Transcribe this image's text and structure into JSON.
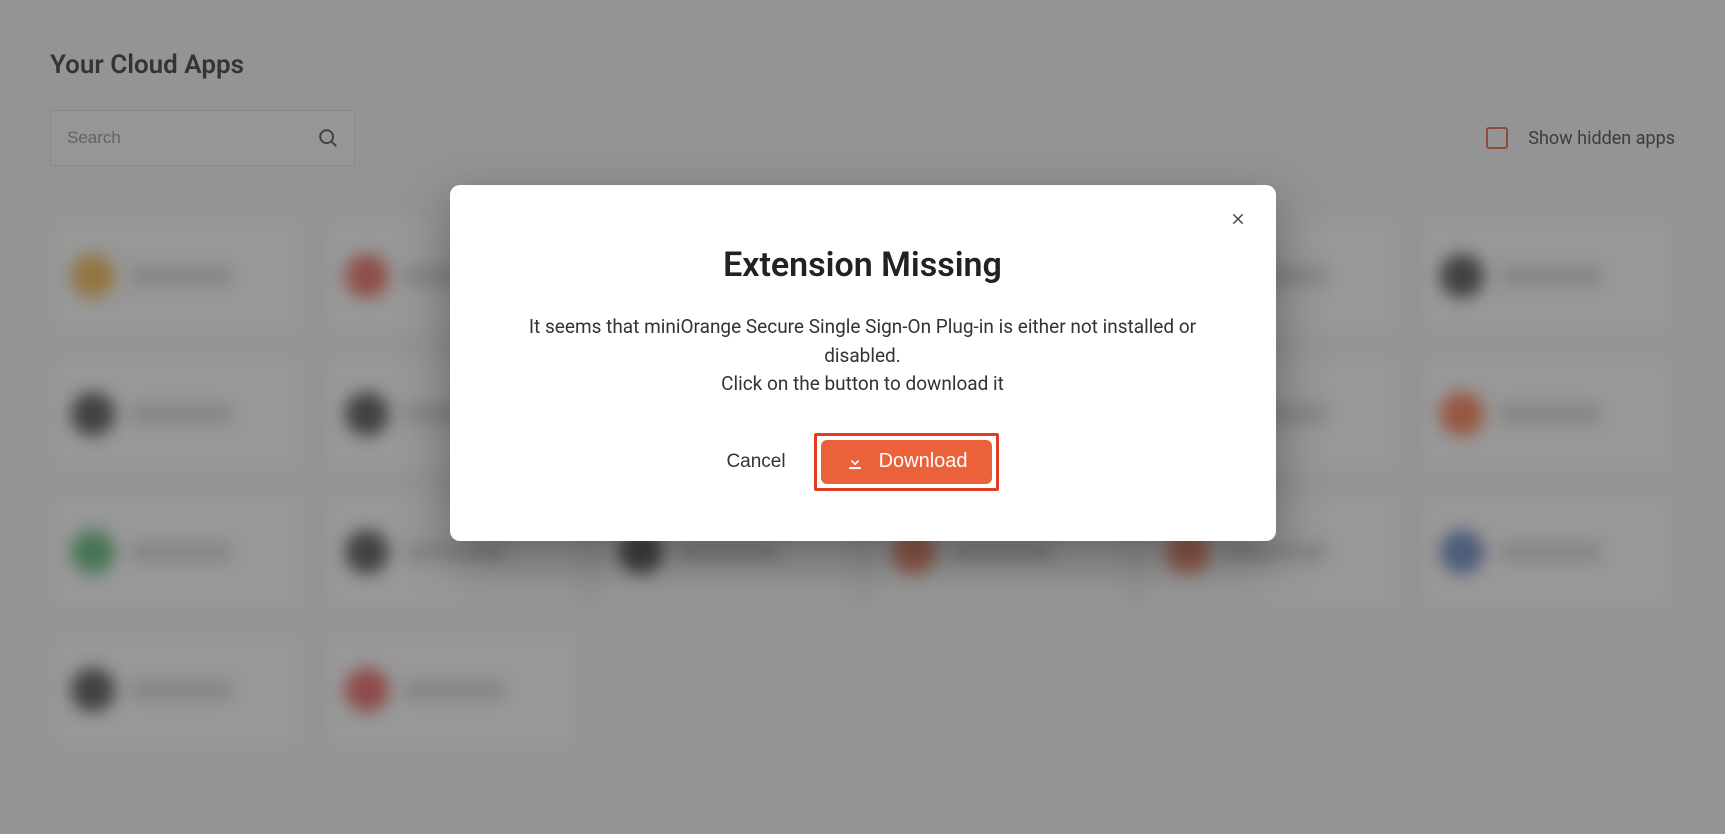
{
  "header": {
    "title": "Your Cloud Apps"
  },
  "search": {
    "placeholder": "Search"
  },
  "hidden_apps": {
    "label": "Show hidden apps"
  },
  "app_icon_colors": [
    "#f5a623",
    "#ea4335",
    "#6b6b6b",
    "#007aff",
    "#333333",
    "#222222",
    "#222222",
    "#222222",
    "#aaaaaa",
    "#eb6139",
    "#d4d4d4",
    "#ff5722",
    "#34a853",
    "#222222",
    "#222222",
    "#eb6139",
    "#eb6139",
    "#4267B2",
    "#222222",
    "#e53935"
  ],
  "modal": {
    "title": "Extension Missing",
    "body_line1": "It seems that miniOrange Secure Single Sign-On Plug-in is either not installed or disabled.",
    "body_line2": "Click on the button to download it",
    "cancel_label": "Cancel",
    "download_label": "Download"
  }
}
